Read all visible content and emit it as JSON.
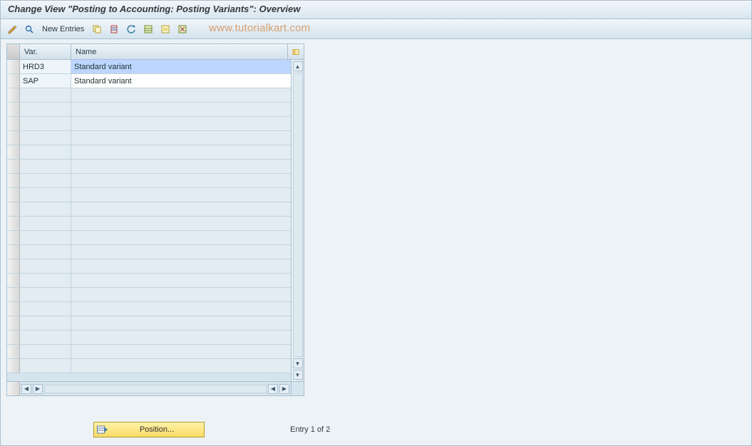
{
  "title": "Change View \"Posting to Accounting: Posting Variants\": Overview",
  "toolbar": {
    "new_entries_label": "New Entries"
  },
  "watermark": "www.tutorialkart.com",
  "table": {
    "columns": {
      "var": "Var.",
      "name": "Name"
    },
    "rows": [
      {
        "var": "HRD3",
        "name": "Standard variant",
        "selected": true
      },
      {
        "var": "SAP",
        "name": "Standard variant",
        "selected": false
      }
    ],
    "empty_row_count": 20
  },
  "footer": {
    "position_label": "Position...",
    "entry_status": "Entry 1 of 2"
  }
}
